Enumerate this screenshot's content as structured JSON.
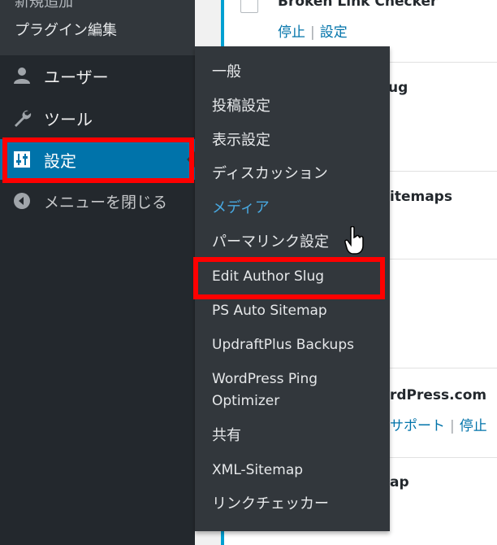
{
  "sidebar": {
    "partial_top": "新規追加",
    "plugin_edit": "プラグイン編集",
    "items": [
      {
        "label": "ユーザー",
        "icon": "user-icon"
      },
      {
        "label": "ツール",
        "icon": "wrench-icon"
      },
      {
        "label": "設定",
        "icon": "settings-sliders-icon"
      },
      {
        "label": "メニューを閉じる",
        "icon": "collapse-menu-icon"
      }
    ]
  },
  "flyout": {
    "items": [
      "一般",
      "投稿設定",
      "表示設定",
      "ディスカッション",
      "メディア",
      "パーマリンク設定",
      "Edit Author Slug",
      "PS Auto Sitemap",
      "UpdraftPlus Backups",
      "WordPress Ping Optimizer",
      "共有",
      "XML-Sitemap",
      "リンクチェッカー"
    ],
    "active": "メディア"
  },
  "plugins": {
    "broken_link": "Broken Link Checker",
    "broken_link_actions": {
      "stop": "停止",
      "settings": "設定"
    },
    "slug_partial": "ug",
    "sitemaps_partial": "itemaps",
    "wpcom_partial": "rdPress.com",
    "wpcom_actions": {
      "support": "サポート",
      "stop": "停止"
    },
    "map_partial": "ap"
  },
  "colors": {
    "sidebar_bg": "#23282d",
    "flyout_bg": "#32373c",
    "accent": "#0073aa",
    "highlight": "#ff0000",
    "active_link": "#48a8e0"
  }
}
